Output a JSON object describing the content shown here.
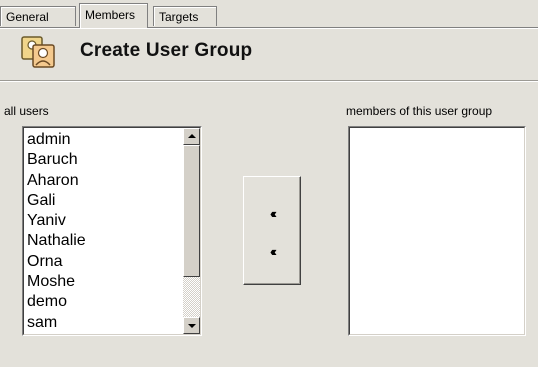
{
  "tabs": [
    {
      "label": "General"
    },
    {
      "label": "Members"
    },
    {
      "label": "Targets"
    }
  ],
  "header": {
    "title": "Create User Group",
    "icon": "user-group-icon"
  },
  "all_users": {
    "label": "all users",
    "items": [
      "admin",
      "Baruch",
      "Aharon",
      "Gali",
      "Yaniv",
      "Nathalie",
      "Orna",
      "Moshe",
      "demo",
      "sam"
    ]
  },
  "members": {
    "label": "members of this user group",
    "items": []
  },
  "move_buttons": {
    "add_glyph": "‹‹‹",
    "remove_glyph": "‹‹‹"
  },
  "colors": {
    "background": "#e3e1da",
    "list_background": "#ffffff"
  }
}
